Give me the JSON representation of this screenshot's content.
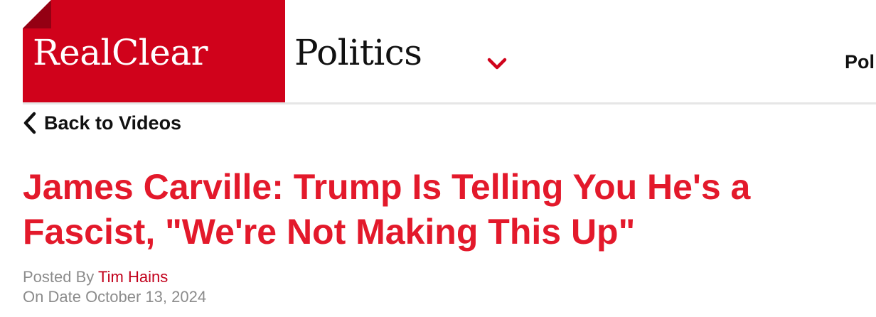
{
  "header": {
    "logo_word_1": "RealClear",
    "logo_word_2": "Politics",
    "logo_menu_icon": "chevron-down-icon",
    "nav_item_partial": "Pol",
    "brand_red": "#d0021b"
  },
  "back_link": {
    "icon": "chevron-left-icon",
    "label": "Back to Videos"
  },
  "article": {
    "title": "James Carville: Trump Is Telling You He's a Fascist, \"We're Not Making This Up\"",
    "title_color": "#e3192b",
    "posted_by_label": "Posted By",
    "author": "Tim Hains",
    "date_label": "On Date",
    "date": "October 13, 2024"
  }
}
